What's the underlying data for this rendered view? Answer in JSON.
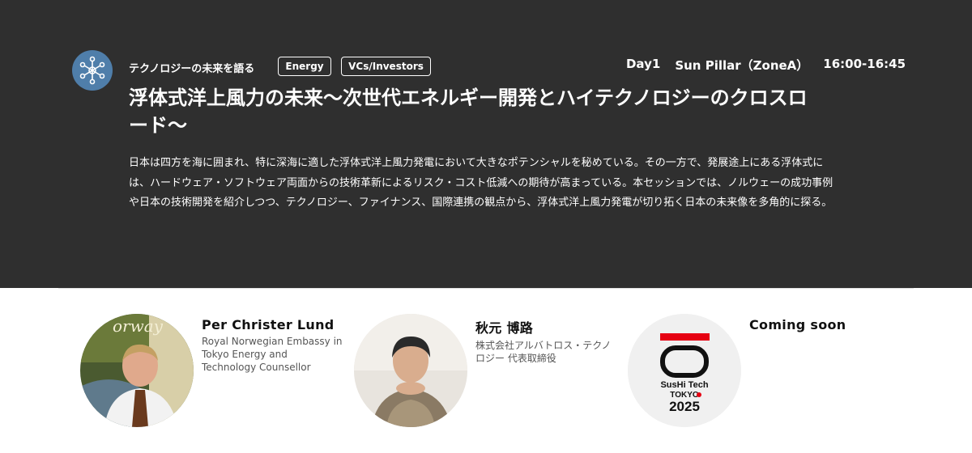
{
  "session": {
    "category": "テクノロジーの未来を語る",
    "tags": [
      "Energy",
      "VCs/Investors"
    ],
    "day": "Day1",
    "venue": "Sun Pillar（ZoneA）",
    "time": "16:00-16:45",
    "title_line1": "浮体式洋上風力の未来〜次世代エネルギー開発とハイテクノロジーのクロスロ",
    "title_line2": "ード〜",
    "description": "日本は四方を海に囲まれ、特に深海に適した浮体式洋上風力発電において大きなポテンシャルを秘めている。その一方で、発展途上にある浮体式には、ハードウェア・ソフトウェア両面からの技術革新によるリスク・コスト低減への期待が高まっている。本セッションでは、ノルウェーの成功事例や日本の技術開発を紹介しつつ、テクノロジー、ファイナンス、国際連携の観点から、浮体式洋上風力発電が切り拓く日本の未来像を多角的に探る。"
  },
  "speakers": [
    {
      "name": "Per Christer Lund",
      "affiliation": "Royal Norwegian Embassy in Tokyo Energy and Technology Counsellor",
      "photo_text": "orway"
    },
    {
      "name": "秋元 博路",
      "affiliation": "株式会社アルバトロス・テクノロジー 代表取締役"
    },
    {
      "name": "Coming soon",
      "logo_text_1": "SusHi Tech",
      "logo_text_2": "TOKYO",
      "logo_text_3": "2025"
    }
  ],
  "colors": {
    "header_bg": "#2f2f2f",
    "category_icon_bg": "#4f7eaa",
    "logo_red": "#e60012"
  },
  "icons": {
    "category": "network-nodes-icon"
  }
}
